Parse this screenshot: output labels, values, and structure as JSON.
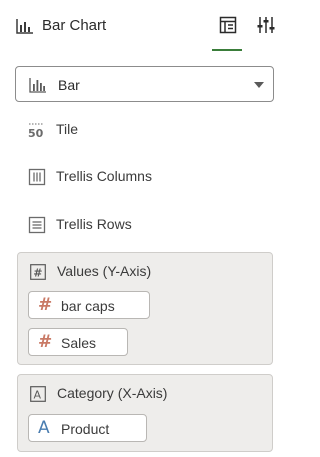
{
  "header": {
    "title": "Bar Chart",
    "title_icon": "bar-chart-icon",
    "tabs": [
      {
        "name": "grammar",
        "icon": "grammar-panel-icon",
        "active": true
      },
      {
        "name": "properties",
        "icon": "sliders-icon",
        "active": false
      }
    ]
  },
  "chart_type_select": {
    "value": "Bar",
    "icon": "bar-chart-icon"
  },
  "drop_targets": [
    {
      "label": "Tile",
      "icon": "tile-50-icon"
    },
    {
      "label": "Trellis Columns",
      "icon": "trellis-columns-icon"
    },
    {
      "label": "Trellis Rows",
      "icon": "trellis-rows-icon"
    }
  ],
  "values_group": {
    "title": "Values (Y-Axis)",
    "icon": "hash-box-icon",
    "items": [
      {
        "label": "bar caps",
        "icon": "#"
      },
      {
        "label": "Sales",
        "icon": "#"
      }
    ]
  },
  "category_group": {
    "title": "Category (X-Axis)",
    "icon": "a-box-icon",
    "items": [
      {
        "label": "Product",
        "icon": "A"
      }
    ]
  },
  "colors": {
    "accent": "#3a7d3a",
    "measure": "#c97a66",
    "attribute": "#4a7db0"
  }
}
